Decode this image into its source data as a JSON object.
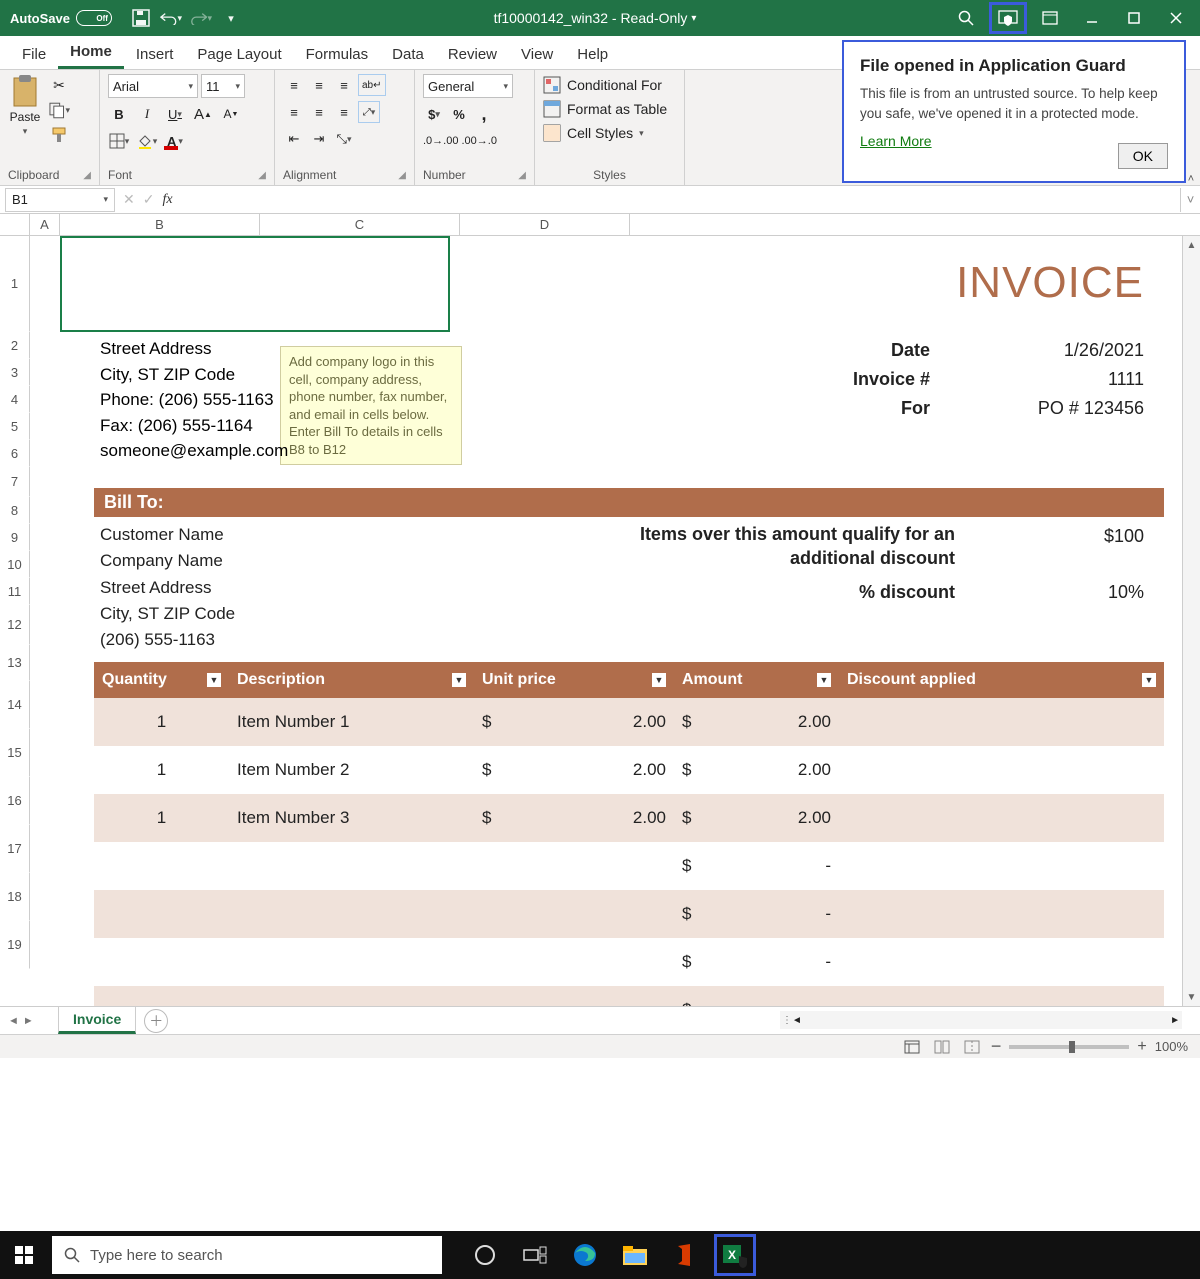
{
  "titlebar": {
    "autosave_label": "AutoSave",
    "autosave_state": "Off",
    "doc_title": "tf10000142_win32 - Read-Only"
  },
  "tabs": {
    "file": "File",
    "home": "Home",
    "insert": "Insert",
    "page_layout": "Page Layout",
    "formulas": "Formulas",
    "data": "Data",
    "review": "Review",
    "view": "View",
    "help": "Help"
  },
  "ribbon": {
    "clipboard": {
      "label": "Clipboard",
      "paste": "Paste"
    },
    "font": {
      "label": "Font",
      "name": "Arial",
      "size": "11"
    },
    "alignment": {
      "label": "Alignment"
    },
    "number": {
      "label": "Number",
      "format": "General"
    },
    "styles": {
      "label": "Styles",
      "conditional": "Conditional For",
      "table": "Format as Table",
      "cell": "Cell Styles"
    }
  },
  "appguard": {
    "title": "File opened in Application Guard",
    "body": "This file is from an untrusted source. To help keep you safe, we've opened it in a protected mode.",
    "learn": "Learn More",
    "ok": "OK"
  },
  "formula_bar": {
    "name_box": "B1"
  },
  "col_headers": {
    "A": "A",
    "B": "B",
    "C": "C",
    "D": "D"
  },
  "row_nums": {
    "r1": "1",
    "r2": "2",
    "r3": "3",
    "r4": "4",
    "r5": "5",
    "r6": "6",
    "r7": "7",
    "r8": "8",
    "r9": "9",
    "r10": "10",
    "r11": "11",
    "r12": "12",
    "r13": "13",
    "r14": "14",
    "r15": "15",
    "r16": "16",
    "r17": "17",
    "r18": "18",
    "r19": "19"
  },
  "invoice": {
    "title": "INVOICE",
    "tooltip": "Add company logo in this cell, company address, phone number, fax number, and email in cells below. Enter Bill To details in cells B8 to B12",
    "addr1": "Street Address",
    "addr2": "City, ST  ZIP Code",
    "addr3": "Phone: (206) 555-1163",
    "addr4": "Fax: (206) 555-1164",
    "addr5": "someone@example.com",
    "date_label": "Date",
    "date_value": "1/26/2021",
    "inv_label": "Invoice #",
    "inv_value": "1111",
    "for_label": "For",
    "for_value": "PO # 123456",
    "billto": "Bill To:",
    "cust1": "Customer Name",
    "cust2": "Company Name",
    "cust3": "Street Address",
    "cust4": "City, ST  ZIP Code",
    "cust5": "(206) 555-1163",
    "qual_label": "Items over this amount qualify for an additional discount",
    "qual_value": "$100",
    "disc_label": "% discount",
    "disc_value": "10%"
  },
  "table": {
    "headers": {
      "q": "Quantity",
      "d": "Description",
      "u": "Unit price",
      "a": "Amount",
      "da": "Discount applied"
    },
    "rows": [
      {
        "q": "1",
        "d": "Item Number 1",
        "uc": "$",
        "uv": "2.00",
        "ac": "$",
        "av": "2.00",
        "da": ""
      },
      {
        "q": "1",
        "d": "Item Number 2",
        "uc": "$",
        "uv": "2.00",
        "ac": "$",
        "av": "2.00",
        "da": ""
      },
      {
        "q": "1",
        "d": "Item Number 3",
        "uc": "$",
        "uv": "2.00",
        "ac": "$",
        "av": "2.00",
        "da": ""
      },
      {
        "q": "",
        "d": "",
        "uc": "",
        "uv": "",
        "ac": "$",
        "av": "-",
        "da": ""
      },
      {
        "q": "",
        "d": "",
        "uc": "",
        "uv": "",
        "ac": "$",
        "av": "-",
        "da": ""
      },
      {
        "q": "",
        "d": "",
        "uc": "",
        "uv": "",
        "ac": "$",
        "av": "-",
        "da": ""
      },
      {
        "q": "",
        "d": "",
        "uc": "",
        "uv": "",
        "ac": "$",
        "av": "-",
        "da": ""
      }
    ]
  },
  "sheet_tab": "Invoice",
  "status": {
    "zoom": "100%"
  },
  "taskbar": {
    "search_placeholder": "Type here to search"
  }
}
